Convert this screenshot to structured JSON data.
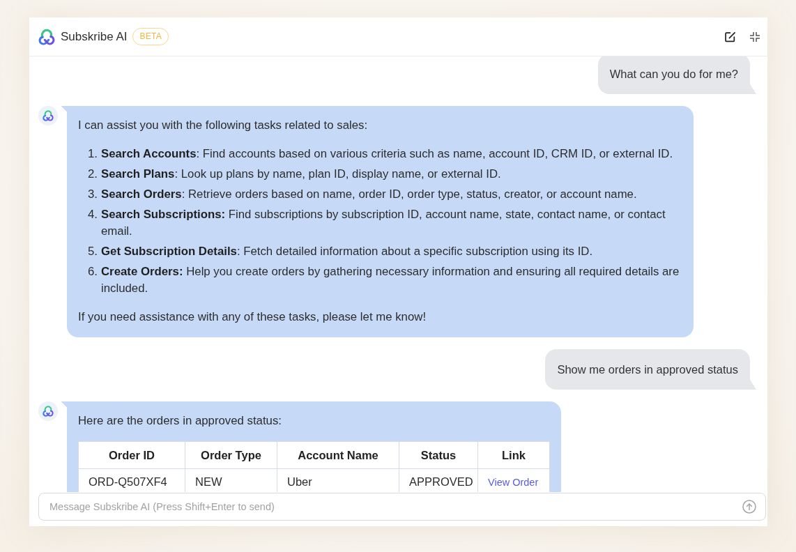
{
  "header": {
    "title": "Subskribe AI",
    "badge": "BETA"
  },
  "messages": [
    {
      "kind": "user",
      "text": "What can you do for me?"
    },
    {
      "kind": "assistant",
      "blocks": [
        {
          "kind": "paragraph",
          "text": "I can assist you with the following tasks related to sales:"
        },
        {
          "kind": "list",
          "items": [
            {
              "number": "1.",
              "text": "**Search Accounts**: Find accounts based on various criteria such as name, account ID, CRM ID, or external ID."
            },
            {
              "number": "2.",
              "text": "**Search Plans**: Look up plans by name, plan ID, display name, or external ID."
            },
            {
              "number": "3.",
              "text": "**Search Orders**: Retrieve orders based on name, order ID, order type, status, creator, or account name."
            },
            {
              "number": "4.",
              "text": "**Search Subscriptions:** Find subscriptions by subscription ID, account name, state, contact name, or contact email."
            },
            {
              "number": "5.",
              "text": "**Get Subscription Details**: Fetch detailed information about a specific subscription using its ID."
            },
            {
              "number": "6.",
              "text": "**Create Orders:** Help you create orders by gathering necessary information and ensuring all required details are included."
            }
          ]
        },
        {
          "kind": "paragraph",
          "text": "If you need assistance with any of these tasks, please let me know!"
        }
      ]
    },
    {
      "kind": "user",
      "text": "Show me orders in approved status"
    },
    {
      "kind": "assistant",
      "blocks": [
        {
          "kind": "paragraph",
          "text": "Here are the orders in approved status:"
        },
        {
          "kind": "table",
          "columns": [
            "Order ID",
            "Order Type",
            "Account Name",
            "Status",
            "Link"
          ],
          "rows": [
            [
              {
                "kind": "text",
                "text": "ORD-Q507XF4"
              },
              {
                "kind": "text",
                "text": "NEW"
              },
              {
                "kind": "text",
                "text": "Uber"
              },
              {
                "kind": "text",
                "text": "APPROVED"
              },
              {
                "kind": "link",
                "text": "View Order"
              }
            ]
          ]
        }
      ]
    }
  ],
  "composer": {
    "placeholder": "Message Subskribe AI (Press Shift+Enter to send)"
  }
}
